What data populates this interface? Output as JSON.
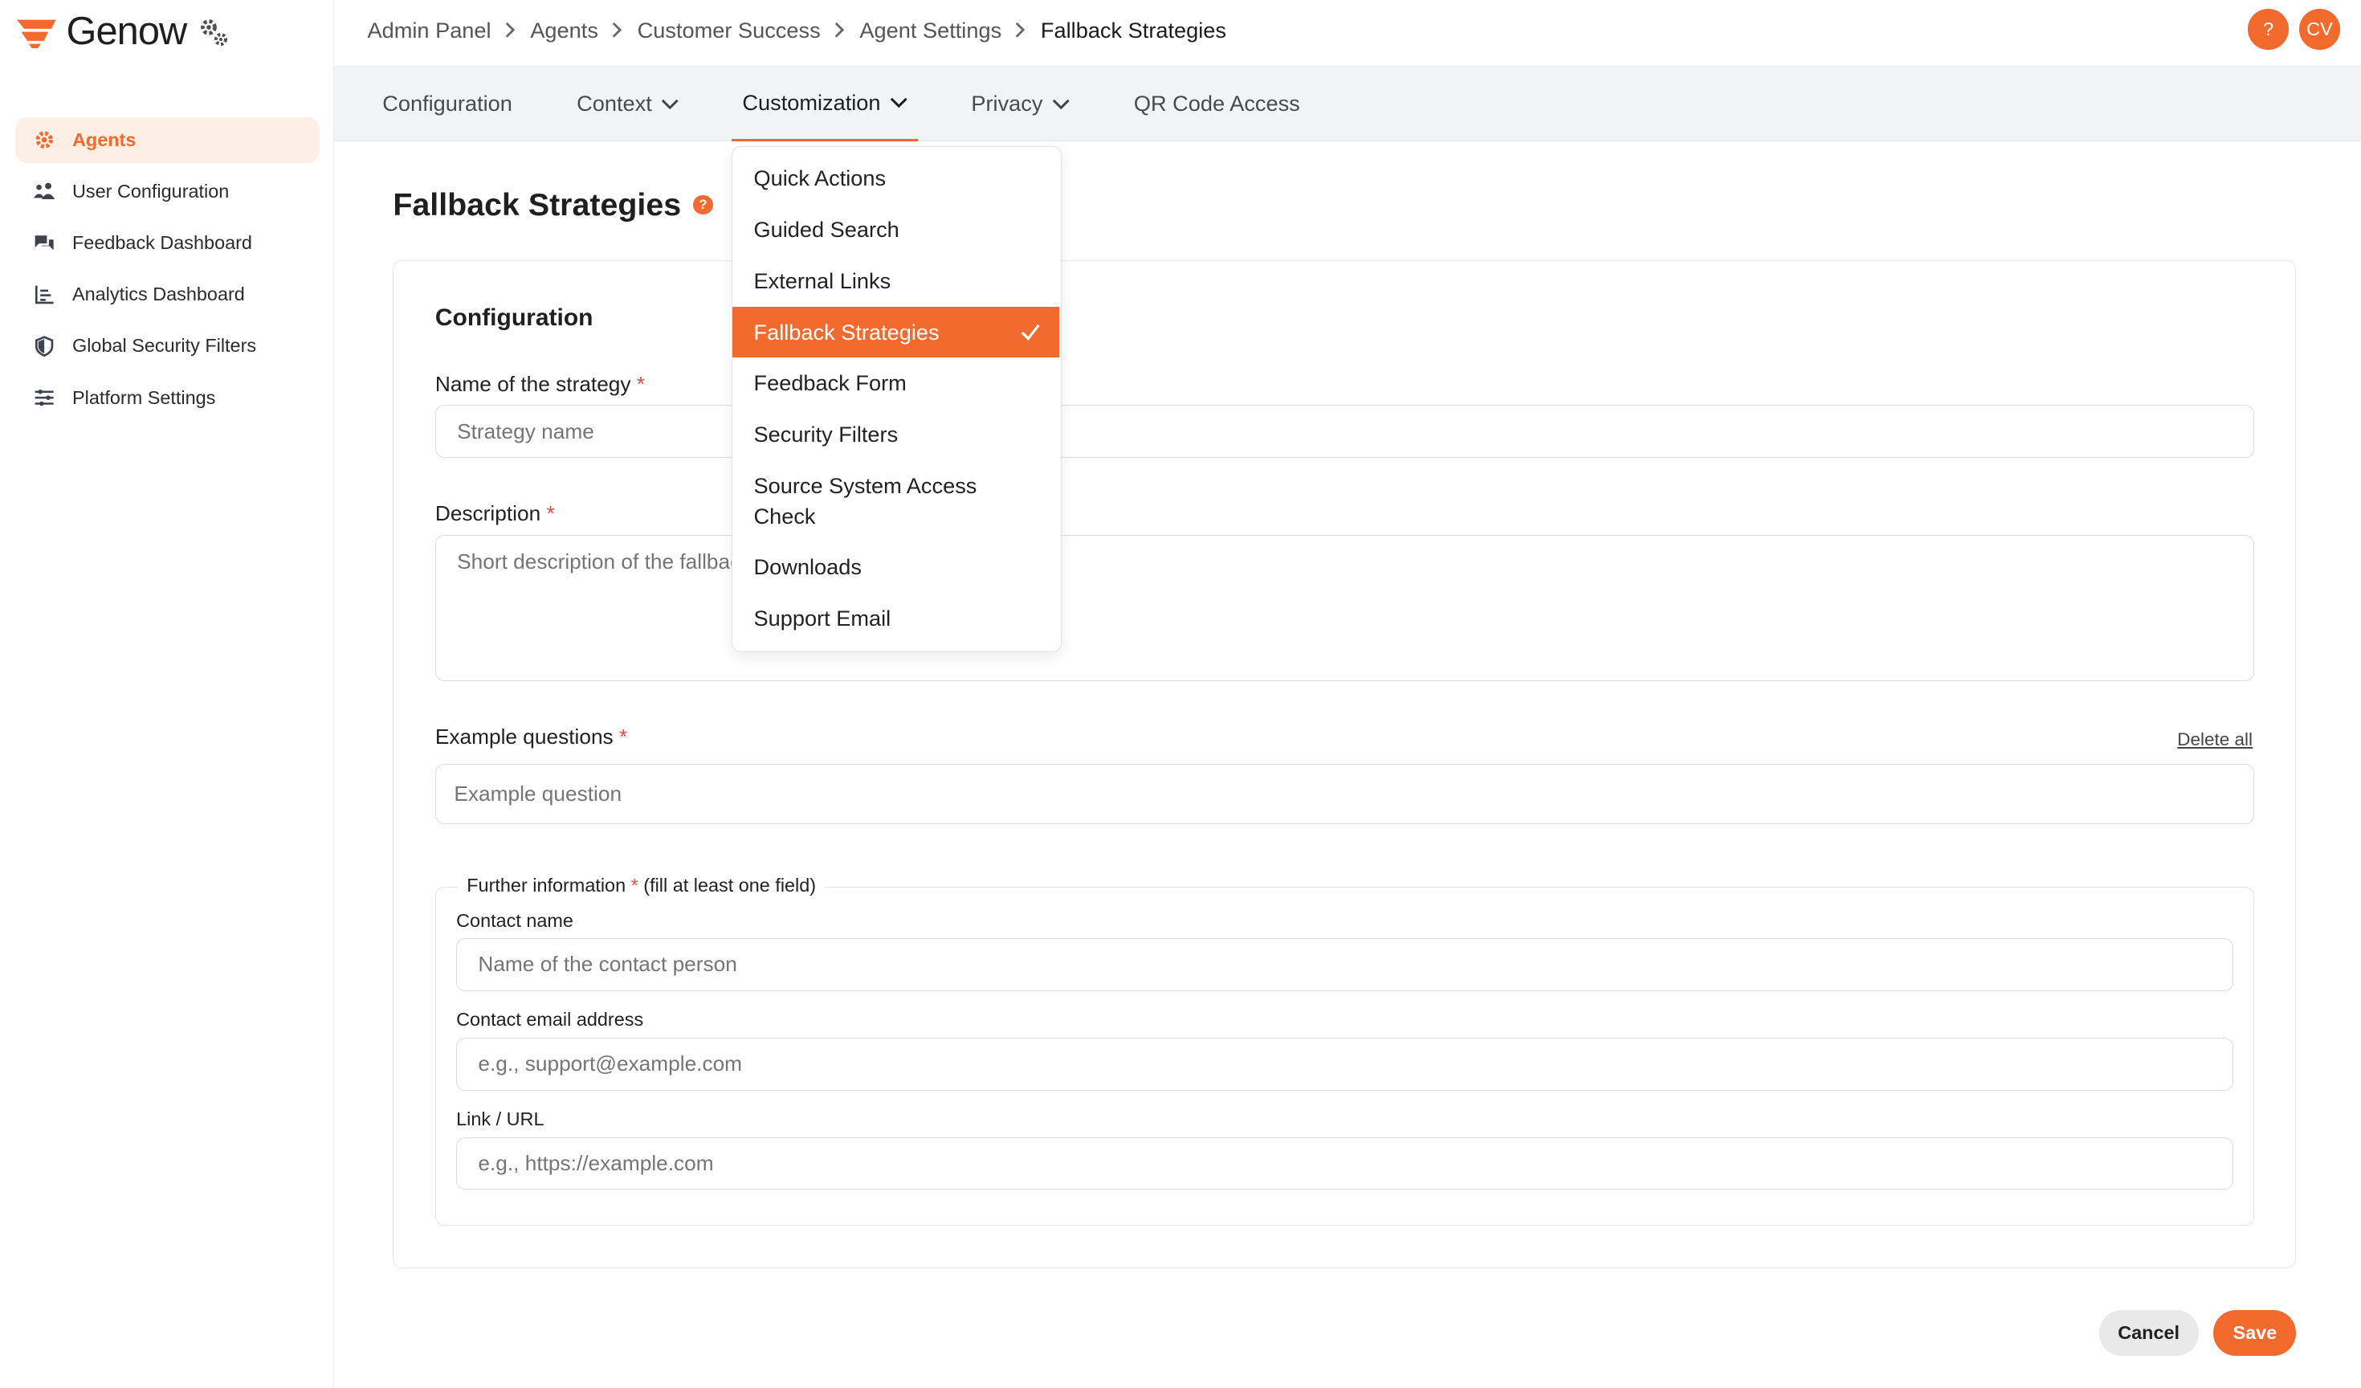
{
  "app": {
    "name": "Genow"
  },
  "sidebar": {
    "items": [
      {
        "label": "Agents",
        "icon": "gear-icon",
        "active": true
      },
      {
        "label": "User Configuration",
        "icon": "users-icon"
      },
      {
        "label": "Feedback Dashboard",
        "icon": "chat-bubbles-icon"
      },
      {
        "label": "Analytics Dashboard",
        "icon": "chart-icon"
      },
      {
        "label": "Global Security Filters",
        "icon": "shield-icon"
      },
      {
        "label": "Platform Settings",
        "icon": "sliders-icon"
      }
    ]
  },
  "breadcrumb": [
    "Admin Panel",
    "Agents",
    "Customer Success",
    "Agent Settings",
    "Fallback Strategies"
  ],
  "header_actions": {
    "help": "?",
    "avatar": "CV"
  },
  "tabs": [
    {
      "label": "Configuration",
      "dropdown": false
    },
    {
      "label": "Context",
      "dropdown": true
    },
    {
      "label": "Customization",
      "dropdown": true,
      "active": true
    },
    {
      "label": "Privacy",
      "dropdown": true
    },
    {
      "label": "QR Code Access",
      "dropdown": false
    }
  ],
  "dropdown": {
    "items": [
      {
        "label": "Quick Actions"
      },
      {
        "label": "Guided Search"
      },
      {
        "label": "External Links"
      },
      {
        "label": "Fallback Strategies",
        "selected": true
      },
      {
        "label": "Feedback Form"
      },
      {
        "label": "Security Filters"
      },
      {
        "label": "Source System Access Check"
      },
      {
        "label": "Downloads"
      },
      {
        "label": "Support Email"
      }
    ]
  },
  "page": {
    "title": "Fallback Strategies",
    "help_icon": "?",
    "section_title": "Configuration",
    "fields": {
      "name": {
        "label": "Name of the strategy",
        "required": "*",
        "placeholder": "Strategy name",
        "value": ""
      },
      "description": {
        "label": "Description",
        "required": "*",
        "placeholder": "Short description of the fallback strategy",
        "value": ""
      },
      "example_questions": {
        "label": "Example questions",
        "required": "*",
        "placeholder": "Example question",
        "delete_all": "Delete all"
      }
    },
    "further_info": {
      "legend": "Further information",
      "required": "*",
      "hint": "(fill at least one field)",
      "contact_name": {
        "label": "Contact name",
        "placeholder": "Name of the contact person"
      },
      "contact_email": {
        "label": "Contact email address",
        "placeholder": "e.g., support@example.com"
      },
      "link": {
        "label": "Link / URL",
        "placeholder": "e.g., https://example.com"
      }
    },
    "actions": {
      "cancel": "Cancel",
      "save": "Save"
    }
  },
  "colors": {
    "accent": "#f36a2f",
    "accent_soft": "#fdefe6",
    "tabbar_bg": "#f1f3f6",
    "required": "#e5484d"
  }
}
